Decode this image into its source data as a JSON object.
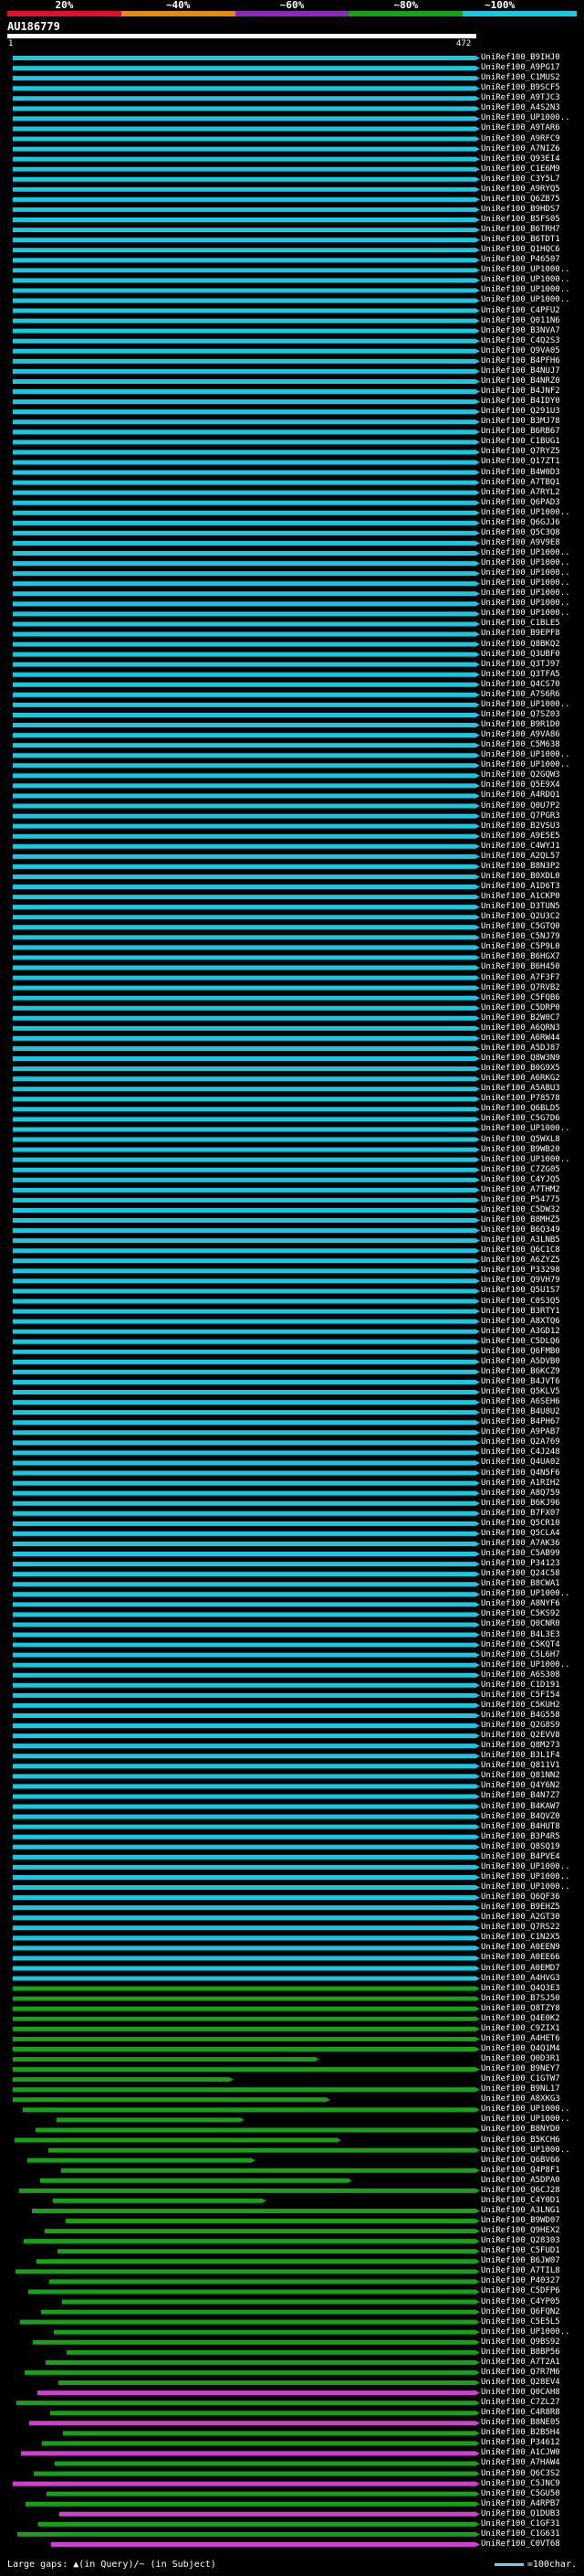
{
  "scale": {
    "labels": [
      "20%",
      "~40%",
      "~60%",
      "~80%",
      "~100%"
    ],
    "colors": [
      "#e0102a",
      "#e88a10",
      "#8a2ab8",
      "#18a018",
      "#18c8e0"
    ]
  },
  "query": {
    "title": "AU186779",
    "start": "1",
    "end": "472"
  },
  "hits": [
    "UniRef100_B9IHJ0",
    "UniRef100_A9PG17",
    "UniRef100_C1MUS2",
    "UniRef100_B9SCF5",
    "UniRef100_A9TJC3",
    "UniRef100_A4S2N3",
    "UniRef100_UP1000..",
    "UniRef100_A9TAR6",
    "UniRef100_A9RFC9",
    "UniRef100_A7NIZ6",
    "UniRef100_Q93EI4",
    "UniRef100_C1E6M9",
    "UniRef100_C3Y5L7",
    "UniRef100_A9RYQ5",
    "UniRef100_Q6ZB75",
    "UniRef100_B9HDS7",
    "UniRef100_B5FS05",
    "UniRef100_B6TRH7",
    "UniRef100_B6TDT1",
    "UniRef100_Q1HQC6",
    "UniRef100_P46507",
    "UniRef100_UP1000..",
    "UniRef100_UP1000..",
    "UniRef100_UP1000..",
    "UniRef100_UP1000..",
    "UniRef100_C4PFU2",
    "UniRef100_Q011N6",
    "UniRef100_B3NVA7",
    "UniRef100_C4Q2S3",
    "UniRef100_Q9VA05",
    "UniRef100_B4PFH6",
    "UniRef100_B4NUJ7",
    "UniRef100_B4NRZ0",
    "UniRef100_B4JNF2",
    "UniRef100_B4IDY0",
    "UniRef100_Q291U3",
    "UniRef100_B3MJ78",
    "UniRef100_B6RB67",
    "UniRef100_C1BUG1",
    "UniRef100_Q7RYZ5",
    "UniRef100_Q17ZT1",
    "UniRef100_B4W0D3",
    "UniRef100_A7TBQ1",
    "UniRef100_A7RYL2",
    "UniRef100_Q6PAD3",
    "UniRef100_UP1000..",
    "UniRef100_Q6GJJ6",
    "UniRef100_Q5C3Q8",
    "UniRef100_A9V9E8",
    "UniRef100_UP1000..",
    "UniRef100_UP1000..",
    "UniRef100_UP1000..",
    "UniRef100_UP1000..",
    "UniRef100_UP1000..",
    "UniRef100_UP1000..",
    "UniRef100_UP1000..",
    "UniRef100_C1BLE5",
    "UniRef100_B9EPF8",
    "UniRef100_Q8BKQ2",
    "UniRef100_Q3UBF0",
    "UniRef100_Q3TJ97",
    "UniRef100_Q3TFA5",
    "UniRef100_Q4CS70",
    "UniRef100_A7S6R6",
    "UniRef100_UP1000..",
    "UniRef100_Q7SZ03",
    "UniRef100_B9R1D0",
    "UniRef100_A9VA86",
    "UniRef100_C5M638",
    "UniRef100_UP1000..",
    "UniRef100_UP1000..",
    "UniRef100_Q2GQW3",
    "UniRef100_Q5E9X4",
    "UniRef100_A4RDQ1",
    "UniRef100_Q0U7P2",
    "UniRef100_Q7PGR3",
    "UniRef100_B2VSU3",
    "UniRef100_A9E5E5",
    "UniRef100_C4WYJ1",
    "UniRef100_A2QL57",
    "UniRef100_B8N3P2",
    "UniRef100_B0XDL0",
    "UniRef100_A1D6T3",
    "UniRef100_A1CKP0",
    "UniRef100_D3TUN5",
    "UniRef100_Q2U3C2",
    "UniRef100_C5GTQ0",
    "UniRef100_C5NJ79",
    "UniRef100_C5P9L0",
    "UniRef100_B6HGX7",
    "UniRef100_B6H450",
    "UniRef100_A7F3F7",
    "UniRef100_Q7RVB2",
    "UniRef100_C5FQB6",
    "UniRef100_C5DRP0",
    "UniRef100_B2W0C7",
    "UniRef100_A6QRN3",
    "UniRef100_A6RW44",
    "UniRef100_A5DJ87",
    "UniRef100_Q8W3N9",
    "UniRef100_B0G9X5",
    "UniRef100_A6RKG2",
    "UniRef100_A5ABU3",
    "UniRef100_P78578",
    "UniRef100_Q6BLD5",
    "UniRef100_C5G7D6",
    "UniRef100_UP1000..",
    "UniRef100_Q5WXL8",
    "UniRef100_B9WB20",
    "UniRef100_UP1000..",
    "UniRef100_C7ZG05",
    "UniRef100_C4YJQ5",
    "UniRef100_A7THM2",
    "UniRef100_P54775",
    "UniRef100_C5DW32",
    "UniRef100_B8MHZ5",
    "UniRef100_B6Q349",
    "UniRef100_A3LNB5",
    "UniRef100_Q6C1C8",
    "UniRef100_A6ZYZ5",
    "UniRef100_P33298",
    "UniRef100_Q9VH79",
    "UniRef100_Q5U1S7",
    "UniRef100_C0S3Q5",
    "UniRef100_B3RTY1",
    "UniRef100_A8XTQ6",
    "UniRef100_A3GD12",
    "UniRef100_C5DLQ6",
    "UniRef100_Q6FMB0",
    "UniRef100_A5DVB0",
    "UniRef100_B6KCZ9",
    "UniRef100_B4JVT6",
    "UniRef100_Q5KLV5",
    "UniRef100_A6SEH6",
    "UniRef100_B4U8U2",
    "UniRef100_B4PH67",
    "UniRef100_A9PAB7",
    "UniRef100_Q2A769",
    "UniRef100_C4J248",
    "UniRef100_Q4UA02",
    "UniRef100_Q4N5F6",
    "UniRef100_A1RIH2",
    "UniRef100_A8Q759",
    "UniRef100_B6KJ96",
    "UniRef100_B7FX07",
    "UniRef100_Q5CR10",
    "UniRef100_Q5CLA4",
    "UniRef100_A7AK36",
    "UniRef100_C5AB99",
    "UniRef100_P34123",
    "UniRef100_Q24C58",
    "UniRef100_B8CWA1",
    "UniRef100_UP1000..",
    "UniRef100_A8NYF6",
    "UniRef100_C5KS92",
    "UniRef100_Q0CNR0",
    "UniRef100_B4L3E3",
    "UniRef100_C5KQT4",
    "UniRef100_C5L6H7",
    "UniRef100_UP1000..",
    "UniRef100_A6S308",
    "UniRef100_C1D191",
    "UniRef100_C5FI54",
    "UniRef100_C5KUH2",
    "UniRef100_B4G558",
    "UniRef100_Q2G8S9",
    "UniRef100_Q2EVV8",
    "UniRef100_Q8M273",
    "UniRef100_B3L1F4",
    "UniRef100_Q811V1",
    "UniRef100_Q81NN2",
    "UniRef100_Q4Y6N2",
    "UniRef100_B4N7Z7",
    "UniRef100_B4KAW7",
    "UniRef100_B4QVZ0",
    "UniRef100_B4HUT8",
    "UniRef100_B3P4R5",
    "UniRef100_Q8SQ19",
    "UniRef100_B4PVE4",
    "UniRef100_UP1000..",
    "UniRef100_UP1000..",
    "UniRef100_UP1000..",
    "UniRef100_Q6QF36",
    "UniRef100_B9EHZ5",
    "UniRef100_A2GT30",
    "UniRef100_Q7RS22",
    "UniRef100_C1N2X5",
    "UniRef100_A0EEN9",
    "UniRef100_A0EE66",
    "UniRef100_A0EMD7",
    "UniRef100_A4HVG3",
    "UniRef100_Q4Q3E3",
    "UniRef100_B7SJ50",
    "UniRef100_Q8TZY8",
    "UniRef100_Q4E0K2",
    "UniRef100_C9ZIX1",
    "UniRef100_A4HET6",
    "UniRef100_Q4Q1M4",
    "UniRef100_Q0D3R1",
    "UniRef100_B9NEY7",
    "UniRef100_C1GTW7",
    "UniRef100_B9NL17",
    "UniRef100_A8XKG3",
    "UniRef100_UP1000..",
    "UniRef100_UP1000..",
    "UniRef100_B8NYD0",
    "UniRef100_B5KCH6",
    "UniRef100_UP1000..",
    "UniRef100_Q6BV66",
    "UniRef100_Q4P8F1",
    "UniRef100_A5DPA0",
    "UniRef100_Q6CJ28",
    "UniRef100_C4Y0D1",
    "UniRef100_A3LNG1",
    "UniRef100_B9WD07",
    "UniRef100_Q9HEX2",
    "UniRef100_Q28303",
    "UniRef100_C5FUD1",
    "UniRef100_B6JW07",
    "UniRef100_A7TIL8",
    "UniRef100_P40327",
    "UniRef100_C5DFP6",
    "UniRef100_C4YP05",
    "UniRef100_Q6FQN2",
    "UniRef100_C5E5L5",
    "UniRef100_UP1000..",
    "UniRef100_Q9BS92",
    "UniRef100_B8BP56",
    "UniRef100_A7T2A1",
    "UniRef100_Q7R7M6",
    "UniRef100_Q28EV4",
    "UniRef100_Q0CAH8",
    "UniRef100_C7ZL27",
    "UniRef100_C4R8R8",
    "UniRef100_B8NE05",
    "UniRef100_B2B5H4",
    "UniRef100_P34612",
    "UniRef100_A1CJW0",
    "UniRef100_A7HAW4",
    "UniRef100_Q6C3S2",
    "UniRef100_C5JNC9",
    "UniRef100_C5GU50",
    "UniRef100_A4RPB7",
    "UniRef100_Q1DUB3",
    "UniRef100_C1GF31",
    "UniRef100_C1G631",
    "UniRef100_C0VT68"
  ],
  "footer": {
    "left": "Large gaps: ▲(in Query)/~ (in Subject)",
    "right": "=100char."
  }
}
